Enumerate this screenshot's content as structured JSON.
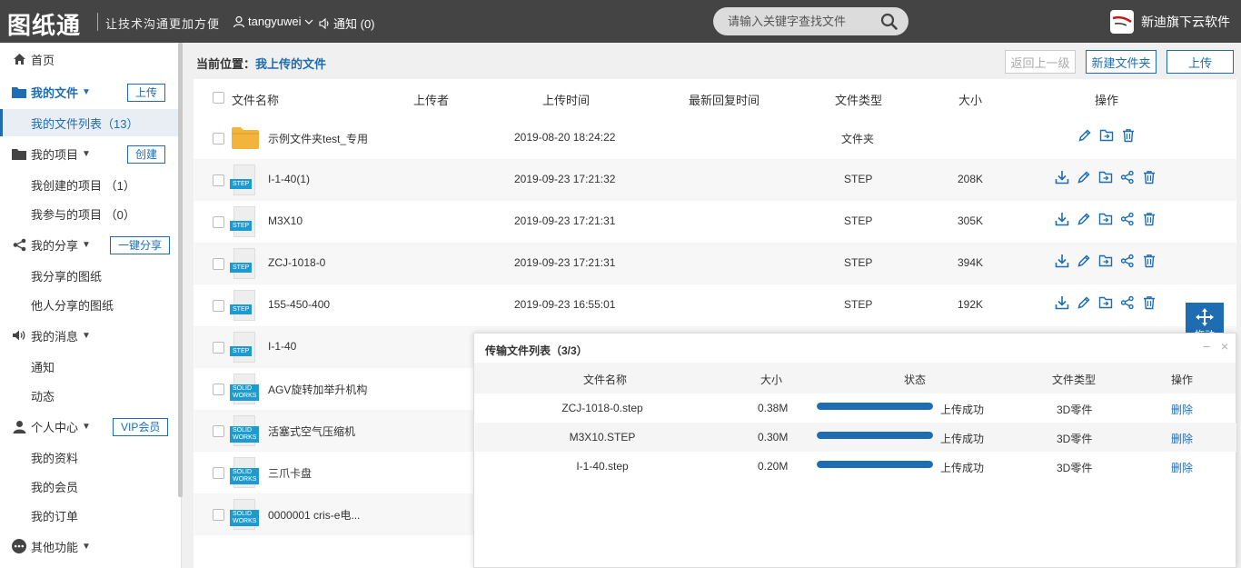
{
  "header": {
    "logo": "图纸通",
    "slogan": "让技术沟通更加方便",
    "username": "tangyuwei",
    "notice": "通知 (0)",
    "search_placeholder": "请输入关键字查找文件",
    "brand": "新迪旗下云软件"
  },
  "sidebar": {
    "home": "首页",
    "my_files": "我的文件",
    "upload_btn": "上传",
    "my_files_list": "我的文件列表（13）",
    "my_projects": "我的项目",
    "create_btn": "创建",
    "created_projects": "我创建的项目 （1）",
    "joined_projects": "我参与的项目 （0）",
    "my_share": "我的分享",
    "share_btn": "一键分享",
    "shared_by_me": "我分享的图纸",
    "shared_by_others": "他人分享的图纸",
    "my_messages": "我的消息",
    "notice": "通知",
    "activity": "动态",
    "personal": "个人中心",
    "vip_btn": "VIP会员",
    "my_profile": "我的资料",
    "my_membership": "我的会员",
    "my_orders": "我的订单",
    "other": "其他功能"
  },
  "toolbar": {
    "crumb_label": "当前位置：",
    "crumb_value": "我上传的文件",
    "back_btn": "返回上一级",
    "new_folder_btn": "新建文件夹",
    "upload_btn": "上传"
  },
  "table": {
    "headers": {
      "name": "文件名称",
      "uploader": "上传者",
      "upload_time": "上传时间",
      "last_reply": "最新回复时间",
      "type": "文件类型",
      "size": "大小",
      "ops": "操作"
    },
    "rows": [
      {
        "name": "示例文件夹test_专用",
        "time": "2019-08-20 18:24:22",
        "type": "文件夹",
        "size": "",
        "icon": "folder-icon"
      },
      {
        "name": "I-1-40(1)",
        "time": "2019-09-23 17:21:32",
        "type": "STEP",
        "size": "208K",
        "icon": "step-file-icon"
      },
      {
        "name": "M3X10",
        "time": "2019-09-23 17:21:31",
        "type": "STEP",
        "size": "305K",
        "icon": "step-file-icon"
      },
      {
        "name": "ZCJ-1018-0",
        "time": "2019-09-23 17:21:31",
        "type": "STEP",
        "size": "394K",
        "icon": "step-file-icon"
      },
      {
        "name": "155-450-400",
        "time": "2019-09-23 16:55:01",
        "type": "STEP",
        "size": "192K",
        "icon": "step-file-icon"
      },
      {
        "name": "I-1-40",
        "time": "",
        "type": "",
        "size": "",
        "icon": "step-file-icon"
      },
      {
        "name": "AGV旋转加举升机构",
        "time": "",
        "type": "",
        "size": "",
        "icon": "solidworks-file-icon"
      },
      {
        "name": "活塞式空气压缩机",
        "time": "",
        "type": "",
        "size": "",
        "icon": "solidworks-file-icon"
      },
      {
        "name": "三爪卡盘",
        "time": "",
        "type": "",
        "size": "",
        "icon": "solidworks-file-icon"
      },
      {
        "name": "0000001 cris-e电...",
        "time": "",
        "type": "",
        "size": "",
        "icon": "solidworks-file-icon"
      }
    ],
    "tag_step": "STEP",
    "tag_sw1": "SOLID",
    "tag_sw2": "WORKS"
  },
  "transfer": {
    "title": "传输文件列表（3/3）",
    "minimize": "−",
    "close": "×",
    "headers": {
      "name": "文件名称",
      "size": "大小",
      "status": "状态",
      "type": "文件类型",
      "ops": "操作"
    },
    "rows": [
      {
        "name": "ZCJ-1018-0.step",
        "size": "0.38M",
        "progress": 1.0,
        "status": "上传成功",
        "type": "3D零件",
        "op": "删除"
      },
      {
        "name": "M3X10.STEP",
        "size": "0.30M",
        "progress": 1.0,
        "status": "上传成功",
        "type": "3D零件",
        "op": "删除"
      },
      {
        "name": "I-1-40.step",
        "size": "0.20M",
        "progress": 1.0,
        "status": "上传成功",
        "type": "3D零件",
        "op": "删除"
      }
    ]
  },
  "drag_label": "拖动",
  "colors": {
    "accent": "#1e6db3",
    "header_bg": "#444444",
    "step_tag": "#1d9bd1",
    "folder": "#f2b43c"
  }
}
